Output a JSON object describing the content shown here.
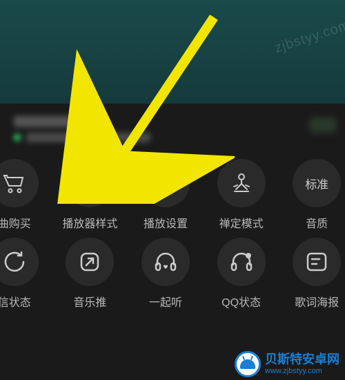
{
  "watermark": {
    "diagonal": "zjbstyy.com",
    "brand_cn": "贝斯特安卓网",
    "brand_url": "www.zjbstyy.com"
  },
  "badge_text": "标准",
  "row1": [
    {
      "name": "purchase",
      "label": "曲购买",
      "icon": "cart"
    },
    {
      "name": "player-style",
      "label": "播放器样式",
      "icon": "shapes"
    },
    {
      "name": "play-settings",
      "label": "播放设置",
      "icon": "equalizer"
    },
    {
      "name": "zen-mode",
      "label": "禅定模式",
      "icon": "meditation"
    },
    {
      "name": "quality",
      "label": "音质",
      "icon": "text"
    }
  ],
  "row2": [
    {
      "name": "status",
      "label": "信状态",
      "icon": "circle-arrow"
    },
    {
      "name": "music-push",
      "label": "音乐推",
      "icon": "share-up"
    },
    {
      "name": "listen-together",
      "label": "一起听",
      "icon": "headphone-heart"
    },
    {
      "name": "qq-status",
      "label": "QQ状态",
      "icon": "headphone-dot"
    },
    {
      "name": "lyric-poster",
      "label": "歌词海报",
      "icon": "picture"
    }
  ]
}
